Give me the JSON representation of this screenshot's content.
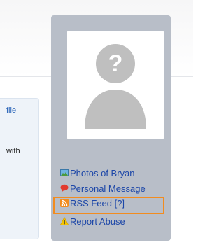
{
  "content": {
    "link_fragment": "file",
    "text_fragment": "with"
  },
  "sidebar": {
    "avatar_icon": "default-user-icon",
    "links": [
      {
        "label": "Photos of Bryan",
        "icon": "photo-icon"
      },
      {
        "label": "Personal Message",
        "icon": "speech-bubble-icon"
      },
      {
        "label": "RSS Feed [?]",
        "icon": "rss-icon",
        "highlighted": true
      },
      {
        "label": "Report Abuse",
        "icon": "warning-icon"
      }
    ]
  },
  "colors": {
    "sidebar_bg": "#b8bec8",
    "link": "#1d47a8",
    "highlight": "#f28c1f"
  }
}
